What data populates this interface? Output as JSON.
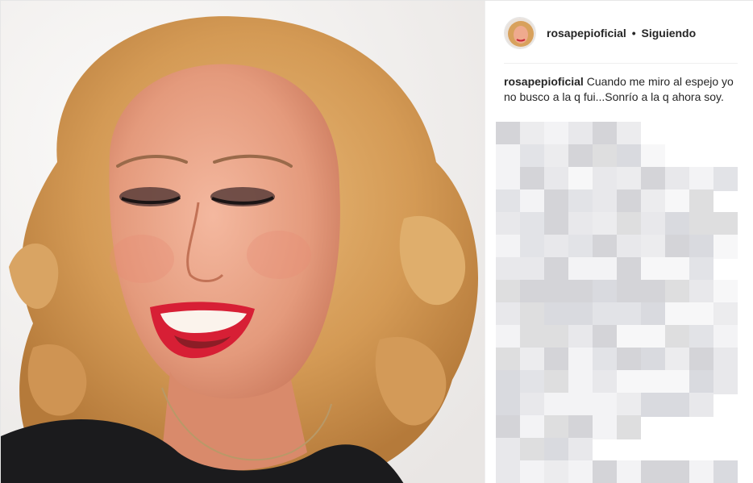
{
  "post": {
    "author": {
      "username": "rosapepioficial",
      "separator": "•",
      "follow_state": "Siguiendo"
    },
    "caption": {
      "username": "rosapepioficial",
      "text": "Cuando me miro al espejo yo no busco a la q fui...Sonrío a la q ahora soy."
    },
    "comments_state": "pixelated",
    "colors": {
      "text": "#262626",
      "divider": "#efefef",
      "border": "#e6e6e6"
    }
  }
}
